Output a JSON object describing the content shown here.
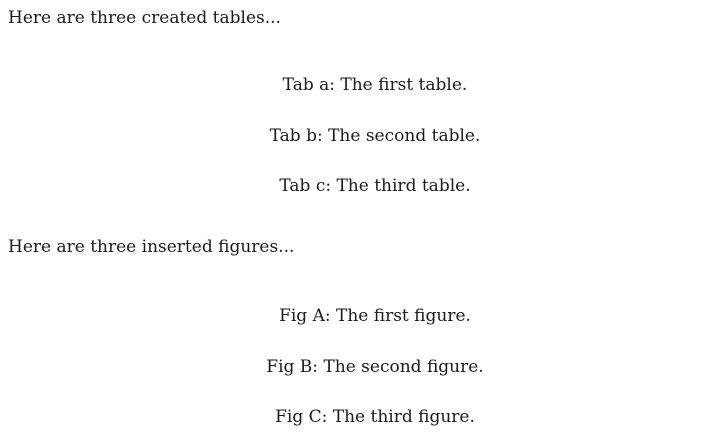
{
  "document": {
    "tables_intro": "Here are three created tables...",
    "tables": [
      {
        "caption": "Tab a: The first table."
      },
      {
        "caption": "Tab b: The second table."
      },
      {
        "caption": "Tab c: The third table."
      }
    ],
    "figures_intro": "Here are three inserted figures...",
    "figures": [
      {
        "caption": "Fig A: The first figure."
      },
      {
        "caption": "Fig B: The second figure."
      },
      {
        "caption": "Fig C: The third figure."
      }
    ]
  }
}
